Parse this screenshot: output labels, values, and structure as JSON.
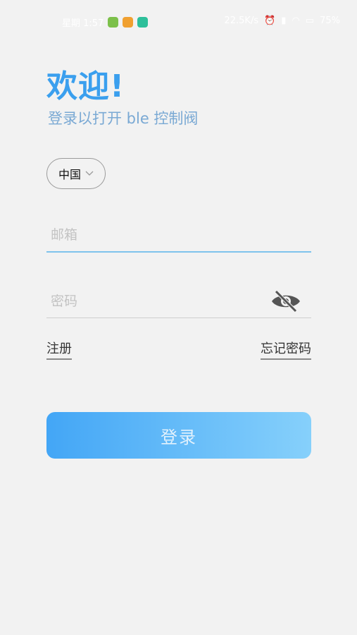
{
  "status_bar": {
    "time": "星期 1:57",
    "speed": "22.5K/s",
    "battery": "75%"
  },
  "header": {
    "welcome": "欢迎!",
    "subtitle": "登录以打开 ble 控制阀"
  },
  "country": {
    "selected": "中国"
  },
  "form": {
    "email_placeholder": "邮箱",
    "password_placeholder": "密码",
    "register_label": "注册",
    "forgot_label": "忘记密码",
    "login_label": "登录"
  },
  "colors": {
    "accent": "#3a9fee",
    "button_start": "#43a6f6",
    "button_end": "#86d0fb"
  }
}
